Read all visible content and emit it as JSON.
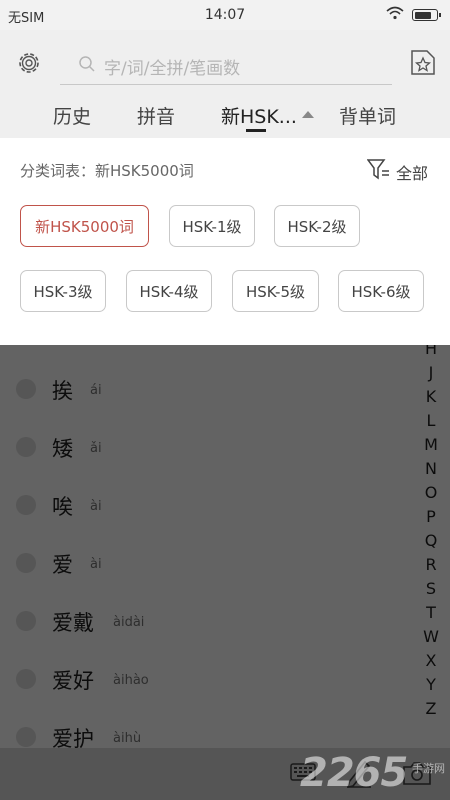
{
  "status": {
    "carrier": "无SIM",
    "time": "14:07"
  },
  "search": {
    "placeholder": "字/词/全拼/笔画数"
  },
  "tabs": [
    {
      "label": "历史"
    },
    {
      "label": "拼音"
    },
    {
      "label": "新HSK..."
    },
    {
      "label": "背单词"
    }
  ],
  "panel": {
    "title": "分类词表：新HSK5000词",
    "filter_label": "全部",
    "chips": [
      {
        "label": "新HSK5000词",
        "selected": true
      },
      {
        "label": "HSK-1级"
      },
      {
        "label": "HSK-2级"
      },
      {
        "label": "HSK-3级"
      },
      {
        "label": "HSK-4级"
      },
      {
        "label": "HSK-5级"
      },
      {
        "label": "HSK-6级"
      }
    ]
  },
  "words": [
    {
      "word": "挨",
      "pinyin": "ái"
    },
    {
      "word": "矮",
      "pinyin": "ǎi"
    },
    {
      "word": "唉",
      "pinyin": "ài"
    },
    {
      "word": "爱",
      "pinyin": "ài"
    },
    {
      "word": "爱戴",
      "pinyin": "àidài"
    },
    {
      "word": "爱好",
      "pinyin": "àihào"
    },
    {
      "word": "爱护",
      "pinyin": "àihù"
    }
  ],
  "alphabet": [
    "H",
    "J",
    "K",
    "L",
    "M",
    "N",
    "O",
    "P",
    "Q",
    "R",
    "S",
    "T",
    "W",
    "X",
    "Y",
    "Z"
  ],
  "watermark": {
    "brand": "2265",
    "sub": "手游网"
  },
  "colors": {
    "accent": "#c0534a",
    "overlay": "#636363"
  }
}
